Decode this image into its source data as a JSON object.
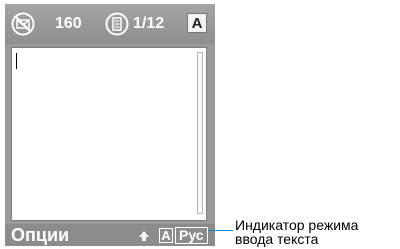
{
  "status_bar": {
    "message_count": "160",
    "page_indicator": "1/12",
    "mode": "A",
    "icons": [
      "no-message-icon",
      "document-icon"
    ]
  },
  "editor": {
    "text": ""
  },
  "softkeys": {
    "left_label": "Опции",
    "arrow_icon": "up-arrow-icon",
    "input_mode_box": "A",
    "input_mode_lang": "Рус"
  },
  "annotation": {
    "line1": "Индикатор режима",
    "line2": "ввода текста"
  },
  "colors": {
    "status_bg": "#9a9a9a",
    "leader_line": "#1a84c9"
  }
}
